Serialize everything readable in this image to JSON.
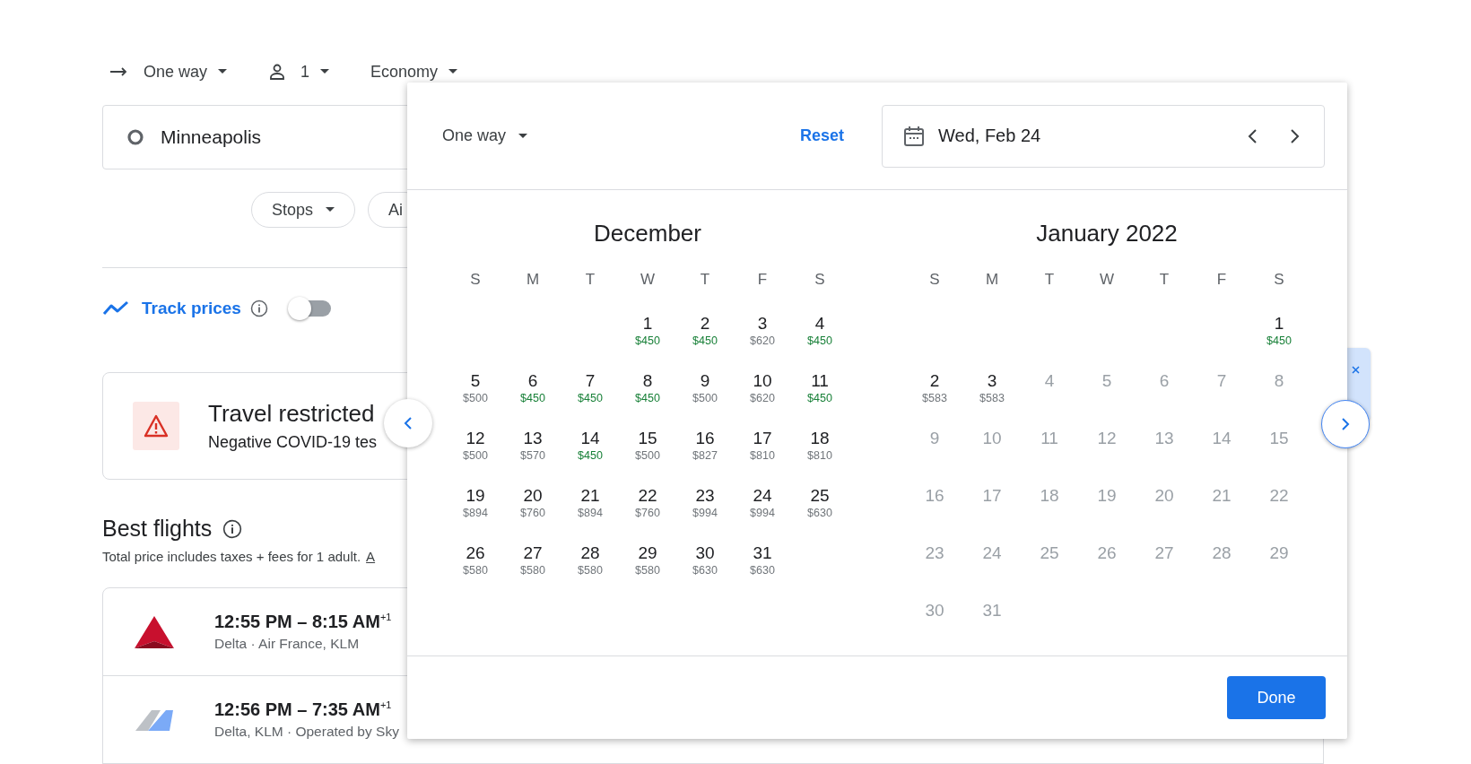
{
  "top_bar": {
    "trip_type": "One way",
    "passengers": "1",
    "cabin": "Economy"
  },
  "origin": {
    "value": "Minneapolis"
  },
  "filters": [
    {
      "label": "Stops",
      "has_menu": true
    },
    {
      "label": "Ai",
      "has_menu": false
    }
  ],
  "track_prices": {
    "label": "Track prices",
    "on": false
  },
  "notice": {
    "title": "Travel restricted",
    "text": "Negative COVID-19 tes"
  },
  "best_flights": {
    "title": "Best flights",
    "subtitle": "Total price includes taxes + fees for 1 adult.",
    "link": "A"
  },
  "flights": [
    {
      "times": "12:55 PM – 8:15 AM$^{+1}$",
      "airlines": "Delta · Air France, KLM",
      "kind": "triangle"
    },
    {
      "times": "12:56 PM – 7:35 AM$^{+1}$",
      "airlines": "Delta, KLM · Operated by Sky",
      "kind": "tail"
    }
  ],
  "date_picker": {
    "trip_type": "One way",
    "reset": "Reset",
    "date": "Wed, Feb 24",
    "done": "Done",
    "months": [
      {
        "title": "December",
        "weekdays": [
          "S",
          "M",
          "T",
          "W",
          "T",
          "F",
          "S"
        ],
        "weeks": [
          [
            {
              "day": "1",
              "price": "$450",
              "cheap": true,
              "disabled": false
            },
            {
              "day": "2",
              "price": "$450",
              "cheap": true,
              "disabled": false
            },
            {
              "day": "3",
              "price": "$620",
              "cheap": false,
              "disabled": false
            },
            {
              "day": "4",
              "price": "$450",
              "cheap": true,
              "disabled": false
            }
          ],
          [
            {
              "day": "5",
              "price": "$500",
              "cheap": false,
              "disabled": false
            },
            {
              "day": "6",
              "price": "$450",
              "cheap": true,
              "disabled": false
            },
            {
              "day": "7",
              "price": "$450",
              "cheap": true,
              "disabled": false
            },
            {
              "day": "8",
              "price": "$450",
              "cheap": true,
              "disabled": false
            },
            {
              "day": "9",
              "price": "$500",
              "cheap": false,
              "disabled": false
            },
            {
              "day": "10",
              "price": "$620",
              "cheap": false,
              "disabled": false
            },
            {
              "day": "11",
              "price": "$450",
              "cheap": true,
              "disabled": false
            }
          ],
          [
            {
              "day": "12",
              "price": "$500",
              "cheap": false,
              "disabled": false
            },
            {
              "day": "13",
              "price": "$570",
              "cheap": false,
              "disabled": false
            },
            {
              "day": "14",
              "price": "$450",
              "cheap": true,
              "disabled": false
            },
            {
              "day": "15",
              "price": "$500",
              "cheap": false,
              "disabled": false
            },
            {
              "day": "16",
              "price": "$827",
              "cheap": false,
              "disabled": false
            },
            {
              "day": "17",
              "price": "$810",
              "cheap": false,
              "disabled": false
            },
            {
              "day": "18",
              "price": "$810",
              "cheap": false,
              "disabled": false
            }
          ],
          [
            {
              "day": "19",
              "price": "$894",
              "cheap": false,
              "disabled": false
            },
            {
              "day": "20",
              "price": "$760",
              "cheap": false,
              "disabled": false
            },
            {
              "day": "21",
              "price": "$894",
              "cheap": false,
              "disabled": false
            },
            {
              "day": "22",
              "price": "$760",
              "cheap": false,
              "disabled": false
            },
            {
              "day": "23",
              "price": "$994",
              "cheap": false,
              "disabled": false
            },
            {
              "day": "24",
              "price": "$994",
              "cheap": false,
              "disabled": false
            },
            {
              "day": "25",
              "price": "$630",
              "cheap": false,
              "disabled": false
            }
          ],
          [
            {
              "day": "26",
              "price": "$580",
              "cheap": false,
              "disabled": false
            },
            {
              "day": "27",
              "price": "$580",
              "cheap": false,
              "disabled": false
            },
            {
              "day": "28",
              "price": "$580",
              "cheap": false,
              "disabled": false
            },
            {
              "day": "29",
              "price": "$580",
              "cheap": false,
              "disabled": false
            },
            {
              "day": "30",
              "price": "$630",
              "cheap": false,
              "disabled": false
            },
            {
              "day": "31",
              "price": "$630",
              "cheap": false,
              "disabled": false
            }
          ]
        ]
      },
      {
        "title": "January 2022",
        "weekdays": [
          "S",
          "M",
          "T",
          "W",
          "T",
          "F",
          "S"
        ],
        "weeks": [
          [
            {
              "day": "1",
              "price": "$450",
              "cheap": true,
              "disabled": false
            }
          ],
          [
            {
              "day": "2",
              "price": "$583",
              "cheap": false,
              "disabled": false
            },
            {
              "day": "3",
              "price": "$583",
              "cheap": false,
              "disabled": false
            },
            {
              "day": "4",
              "disabled": true
            },
            {
              "day": "5",
              "disabled": true
            },
            {
              "day": "6",
              "disabled": true
            },
            {
              "day": "7",
              "disabled": true
            },
            {
              "day": "8",
              "disabled": true
            }
          ],
          [
            {
              "day": "9",
              "disabled": true
            },
            {
              "day": "10",
              "disabled": true
            },
            {
              "day": "11",
              "disabled": true
            },
            {
              "day": "12",
              "disabled": true
            },
            {
              "day": "13",
              "disabled": true
            },
            {
              "day": "14",
              "disabled": true
            },
            {
              "day": "15",
              "disabled": true
            }
          ],
          [
            {
              "day": "16",
              "disabled": true
            },
            {
              "day": "17",
              "disabled": true
            },
            {
              "day": "18",
              "disabled": true
            },
            {
              "day": "19",
              "disabled": true
            },
            {
              "day": "20",
              "disabled": true
            },
            {
              "day": "21",
              "disabled": true
            },
            {
              "day": "22",
              "disabled": true
            }
          ],
          [
            {
              "day": "23",
              "disabled": true
            },
            {
              "day": "24",
              "disabled": true
            },
            {
              "day": "25",
              "disabled": true
            },
            {
              "day": "26",
              "disabled": true
            },
            {
              "day": "27",
              "disabled": true
            },
            {
              "day": "28",
              "disabled": true
            },
            {
              "day": "29",
              "disabled": true
            }
          ],
          [
            {
              "day": "30",
              "disabled": true
            },
            {
              "day": "31",
              "disabled": true
            }
          ]
        ]
      }
    ]
  }
}
